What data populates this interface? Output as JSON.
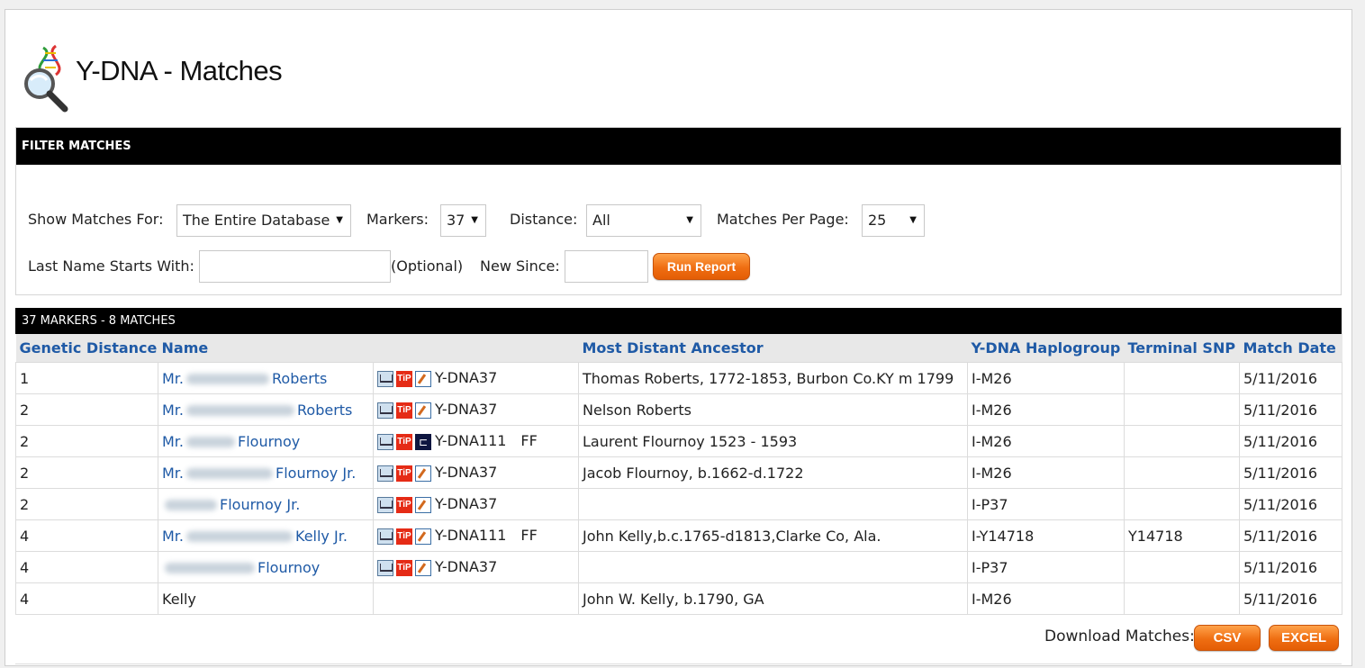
{
  "page": {
    "title": "Y-DNA - Matches"
  },
  "filter": {
    "header": "FILTER MATCHES",
    "show_label": "Show Matches For:",
    "show_value": "The Entire Database",
    "markers_label": "Markers:",
    "markers_value": "37",
    "distance_label": "Distance:",
    "distance_value": "All",
    "per_page_label": "Matches Per Page:",
    "per_page_value": "25",
    "lastname_label": "Last Name Starts With:",
    "lastname_value": "",
    "optional_label": "(Optional)",
    "newsince_label": "New Since:",
    "newsince_value": "",
    "run_button": "Run Report"
  },
  "results": {
    "summary": "37 MARKERS - 8 MATCHES",
    "columns": {
      "distance": "Genetic Distance",
      "name": "Name",
      "tools": "",
      "ancestor": "Most Distant Ancestor",
      "haplogroup": "Y-DNA Haplogroup",
      "snp": "Terminal SNP",
      "date": "Match Date"
    },
    "rows": [
      {
        "distance": "1",
        "prefix": "Mr.",
        "surname": "Roberts",
        "test": "Y-DNA37",
        "ff": "",
        "ancestor": "Thomas Roberts, 1772-1853, Burbon Co.KY m 1799",
        "haplogroup": "I-M26",
        "snp": "",
        "date": "5/11/2016"
      },
      {
        "distance": "2",
        "prefix": "Mr.",
        "surname": "Roberts",
        "test": "Y-DNA37",
        "ff": "",
        "ancestor": "Nelson Roberts",
        "haplogroup": "I-M26",
        "snp": "",
        "date": "5/11/2016"
      },
      {
        "distance": "2",
        "prefix": "Mr.",
        "surname": "Flournoy",
        "test": "Y-DNA111",
        "ff": "FF",
        "ancestor": "Laurent Flournoy 1523 - 1593",
        "haplogroup": "I-M26",
        "snp": "",
        "date": "5/11/2016"
      },
      {
        "distance": "2",
        "prefix": "Mr.",
        "surname": "Flournoy Jr.",
        "test": "Y-DNA37",
        "ff": "",
        "ancestor": "Jacob Flournoy, b.1662-d.1722",
        "haplogroup": "I-M26",
        "snp": "",
        "date": "5/11/2016"
      },
      {
        "distance": "2",
        "prefix": "",
        "surname": "Flournoy Jr.",
        "test": "Y-DNA37",
        "ff": "",
        "ancestor": "",
        "haplogroup": "I-P37",
        "snp": "",
        "date": "5/11/2016"
      },
      {
        "distance": "4",
        "prefix": "Mr.",
        "surname": "Kelly Jr.",
        "test": "Y-DNA111",
        "ff": "FF",
        "ancestor": "John Kelly,b.c.1765-d1813,Clarke Co, Ala.",
        "haplogroup": "I-Y14718",
        "snp": "Y14718",
        "date": "5/11/2016"
      },
      {
        "distance": "4",
        "prefix": "",
        "surname": "Flournoy",
        "test": "Y-DNA37",
        "ff": "",
        "ancestor": "",
        "haplogroup": "I-P37",
        "snp": "",
        "date": "5/11/2016"
      },
      {
        "distance": "4",
        "prefix": "",
        "surname": "Kelly",
        "test": "",
        "ff": "",
        "ancestor": "John W. Kelly, b.1790, GA",
        "haplogroup": "I-M26",
        "snp": "",
        "date": "5/11/2016"
      }
    ]
  },
  "download": {
    "label": "Download Matches:",
    "csv": "CSV",
    "excel": "EXCEL"
  },
  "colors": {
    "link": "#1f5aa6",
    "accent": "#ef6e12",
    "header_bar": "#000000"
  }
}
